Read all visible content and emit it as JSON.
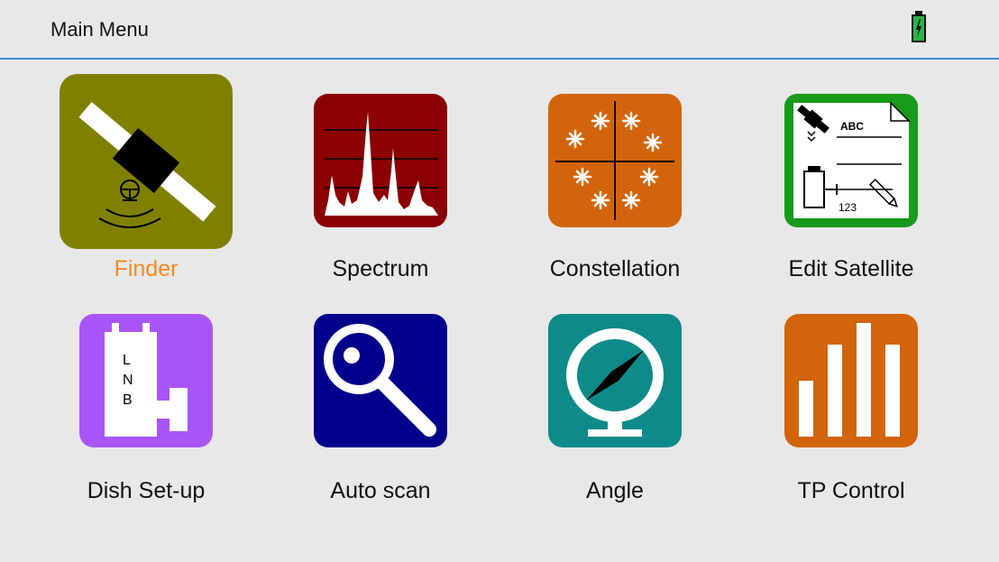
{
  "header": {
    "title": "Main Menu",
    "battery_icon": "battery-charging-icon",
    "battery_color": "#2db34a"
  },
  "menu": {
    "items": [
      {
        "label": "Finder",
        "icon": "satellite-finder-icon",
        "color": "#808000",
        "selected": true
      },
      {
        "label": "Spectrum",
        "icon": "spectrum-icon",
        "color": "#8b0000",
        "selected": false
      },
      {
        "label": "Constellation",
        "icon": "constellation-icon",
        "color": "#d2650b",
        "selected": false
      },
      {
        "label": "Edit Satellite",
        "icon": "edit-satellite-icon",
        "color": "#1a9a1a",
        "selected": false
      },
      {
        "label": "Dish Set-up",
        "icon": "lnb-icon",
        "color": "#a855f7",
        "selected": false
      },
      {
        "label": "Auto scan",
        "icon": "magnifier-icon",
        "color": "#00008b",
        "selected": false
      },
      {
        "label": "Angle",
        "icon": "compass-icon",
        "color": "#0e8a8a",
        "selected": false
      },
      {
        "label": "TP Control",
        "icon": "bar-chart-icon",
        "color": "#d2650b",
        "selected": false
      }
    ],
    "lnb_letters": [
      "L",
      "N",
      "B"
    ],
    "edit_satellite_text_abc": "ABC",
    "edit_satellite_text_123": "123"
  }
}
